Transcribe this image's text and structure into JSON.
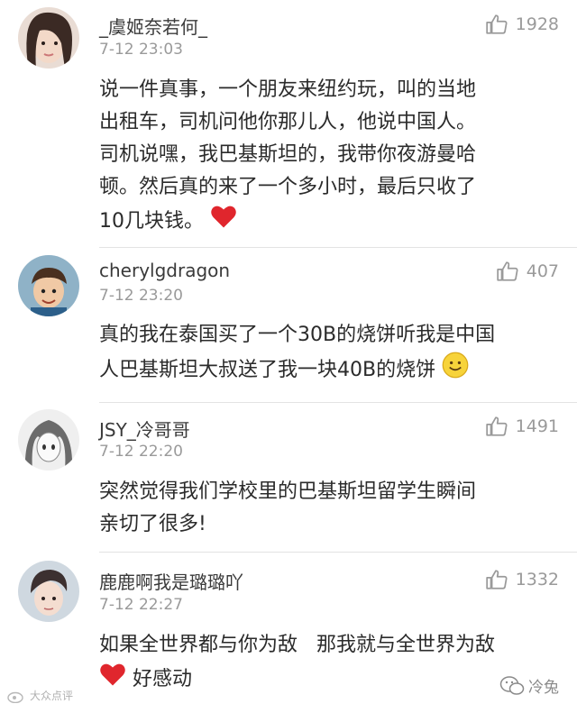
{
  "comments": [
    {
      "username": "_虞姬奈若何_",
      "time": "7-12 23:03",
      "likes": "1928",
      "lines": [
        "说一件真事，一个朋友来纽约玩，叫的当地",
        "出租车，司机问他你那儿人，他说中国人。",
        "司机说嘿，我巴基斯坦的，我带你夜游曼哈",
        "顿。然后真的来了一个多小时，最后只收了",
        "10几块钱。"
      ],
      "trailing_emoji": "heart-emoji"
    },
    {
      "username": "cherylgdragon",
      "time": "7-12 23:20",
      "likes": "407",
      "lines": [
        "真的我在泰国买了一个30B的烧饼听我是中国",
        "人巴基斯坦大叔送了我一块40B的烧饼"
      ],
      "trailing_emoji": "smile-emoji"
    },
    {
      "username": "JSY_冷哥哥",
      "time": "7-12 22:20",
      "likes": "1491",
      "lines": [
        "突然觉得我们学校里的巴基斯坦留学生瞬间",
        "亲切了很多!"
      ]
    },
    {
      "username": "鹿鹿啊我是璐璐吖",
      "time": "7-12 22:27",
      "likes": "1332",
      "lines": [
        "如果全世界都与你为敌   那我就与全世界为敌",
        "好感动"
      ],
      "leading_emoji_line2": "heart-emoji"
    }
  ],
  "watermark_left": "大众点评",
  "watermark_right": "冷兔"
}
